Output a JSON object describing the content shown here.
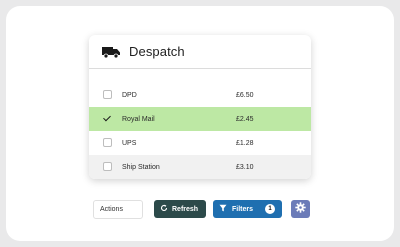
{
  "panel": {
    "title": "Despatch",
    "icon": "truck-icon"
  },
  "carriers": [
    {
      "name": "DPD",
      "price": "£6.50",
      "selected": false
    },
    {
      "name": "Royal Mail",
      "price": "£2.45",
      "selected": true
    },
    {
      "name": "UPS",
      "price": "£1.28",
      "selected": false
    },
    {
      "name": "Ship Station",
      "price": "£3.10",
      "selected": false
    }
  ],
  "toolbar": {
    "actions_label": "Actions",
    "refresh_label": "Refresh",
    "filters_label": "Filters",
    "filters_count": "1",
    "settings_icon": "gear-icon"
  },
  "colors": {
    "selected_row": "#bde8a4",
    "refresh_button": "#2c4a4a",
    "filters_button": "#1f6fb0",
    "settings_button": "#6b7bb8"
  }
}
